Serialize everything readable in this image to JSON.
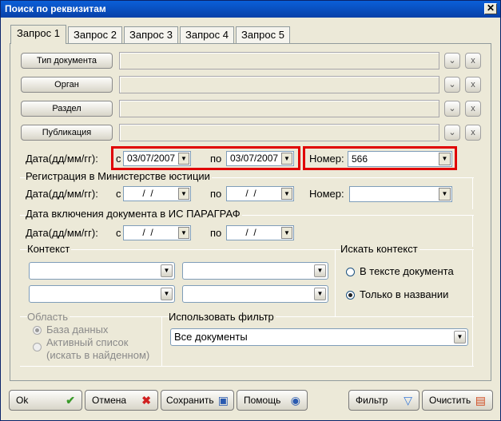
{
  "window": {
    "title": "Поиск по реквизитам",
    "close_glyph": "✕"
  },
  "tabs": [
    "Запрос 1",
    "Запрос 2",
    "Запрос 3",
    "Запрос 4",
    "Запрос 5"
  ],
  "rows": [
    {
      "button": "Тип документа"
    },
    {
      "button": "Орган"
    },
    {
      "button": "Раздел"
    },
    {
      "button": "Публикация"
    }
  ],
  "date_row": {
    "label": "Дата(дд/мм/гг):",
    "from_label": "с",
    "from_value": "03/07/2007",
    "to_label": "по",
    "to_value": "03/07/2007",
    "number_label": "Номер:",
    "number_value": "566"
  },
  "registration": {
    "title": "Регистрация в Министерстве юстиции",
    "label": "Дата(дд/мм/гг):",
    "from_label": "с",
    "from_value": " /  / ",
    "to_label": "по",
    "to_value": " /  / ",
    "number_label": "Номер:"
  },
  "inclusion": {
    "title": "Дата включения документа в ИС ПАРАГРАФ",
    "label": "Дата(дд/мм/гг):",
    "from_label": "с",
    "from_value": " /  / ",
    "to_label": "по",
    "to_value": " /  / "
  },
  "context": {
    "title": "Контекст",
    "search_title": "Искать контекст",
    "options": [
      "В тексте документа",
      "Только в названии"
    ],
    "selected": "Только в названии"
  },
  "area": {
    "title": "Область",
    "options": [
      "База данных",
      "Активный список",
      "(искать в найденном)"
    ]
  },
  "filter": {
    "title": "Использовать фильтр",
    "value": "Все документы"
  },
  "buttons": {
    "ok": "Ok",
    "cancel": "Отмена",
    "save": "Сохранить",
    "help": "Помощь",
    "filter": "Фильтр",
    "clear": "Очистить"
  },
  "colors": {
    "highlight": "#e00000",
    "ok_check": "#3a9a2a",
    "cancel_x": "#d02020"
  }
}
